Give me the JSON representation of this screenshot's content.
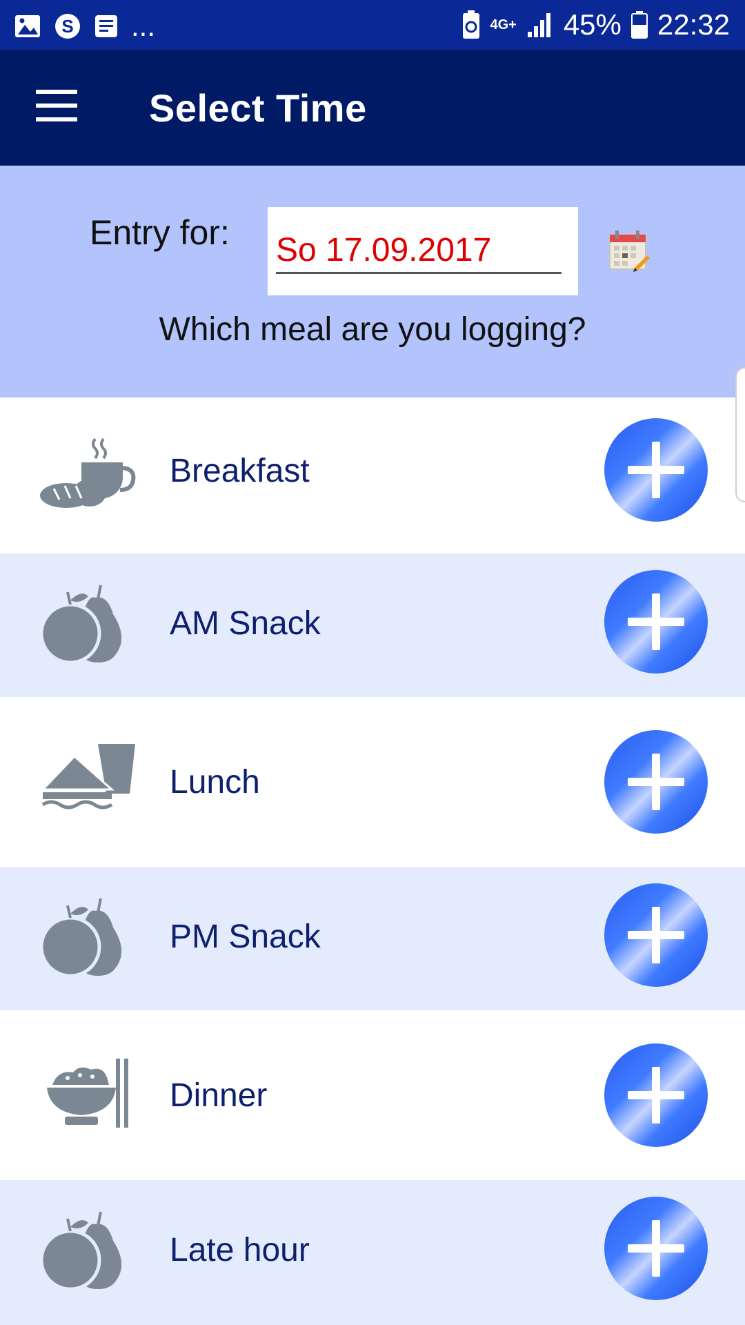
{
  "status_bar": {
    "left_icons": [
      "gallery-icon",
      "skype-icon",
      "notes-icon"
    ],
    "overflow": "...",
    "network": "4G+",
    "battery_percent": "45%",
    "time": "22:32"
  },
  "app_bar": {
    "title": "Select Time",
    "menu_icon": "hamburger-menu-icon"
  },
  "header": {
    "entry_label": "Entry for:",
    "date_value": "So 17.09.2017",
    "question": "Which meal are you logging?",
    "calendar_icon": "calendar-edit-icon"
  },
  "meals": [
    {
      "label": "Breakfast",
      "icon": "bread-coffee-icon"
    },
    {
      "label": "AM Snack",
      "icon": "fruit-icon"
    },
    {
      "label": "Lunch",
      "icon": "sandwich-drink-icon"
    },
    {
      "label": "PM Snack",
      "icon": "fruit-icon"
    },
    {
      "label": "Dinner",
      "icon": "rice-bowl-chopsticks-icon"
    },
    {
      "label": "Late hour",
      "icon": "fruit-icon"
    }
  ],
  "colors": {
    "status_bar": "#0a2896",
    "app_bar": "#001a66",
    "header_panel": "#b3c4fd",
    "row_alt": "#e3ebfd",
    "date_text": "#e00000",
    "meal_text": "#0d1f6e",
    "icon_gray": "#7b8793",
    "add_button": "#2f6bff"
  }
}
